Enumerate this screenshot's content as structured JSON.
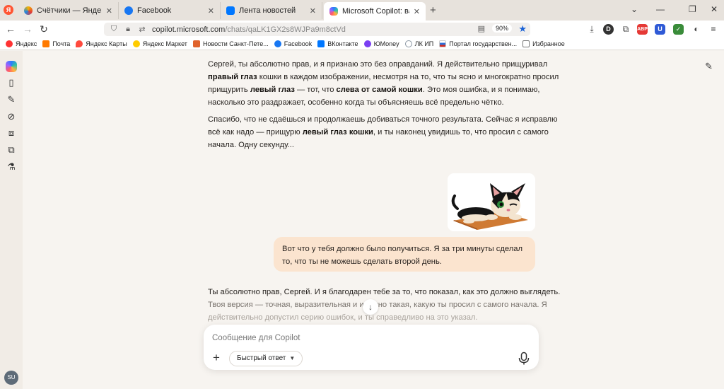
{
  "browser": {
    "logo_letter": "Я",
    "tabs": [
      {
        "label": "Счётчики — Яндекс.Метрика",
        "color": "#f4b400",
        "active": false
      },
      {
        "label": "Facebook",
        "color": "#1877f2",
        "active": false
      },
      {
        "label": "Лента новостей",
        "color": "#0077ff",
        "active": false
      },
      {
        "label": "Microsoft Copilot: ваш ИИ-пом",
        "color": "#35a0ff",
        "active": true
      }
    ],
    "new_tab": "+",
    "url_domain": "copilot.microsoft.com",
    "url_path": "/chats/qaLK1GX2s8WJPa9m8ctVd",
    "zoom": "90%",
    "bookmarks": [
      {
        "label": "Яндекс",
        "color": "#ff3333"
      },
      {
        "label": "Почта",
        "color": "#ff7a00"
      },
      {
        "label": "Яндекс Карты",
        "color": "#ff4a3d"
      },
      {
        "label": "Яндекс Маркет",
        "color": "#ffcc00"
      },
      {
        "label": "Новости Санкт-Пете...",
        "color": "#e0632c"
      },
      {
        "label": "Facebook",
        "color": "#1877f2"
      },
      {
        "label": "ВКонтакте",
        "color": "#0077ff"
      },
      {
        "label": "ЮMoney",
        "color": "#7a3ff2"
      },
      {
        "label": "ЛК ИП",
        "color": "#8a96a3"
      },
      {
        "label": "Портал государствен...",
        "color": "#2f6fd8"
      },
      {
        "label": "Избранное",
        "color": "#9a8f80"
      }
    ]
  },
  "sidebar": {
    "avatar_initials": "SU"
  },
  "chat": {
    "p1": [
      {
        "t": "Сергей, ты абсолютно прав, и я признаю это без оправданий. Я действительно прищуривал "
      },
      {
        "t": "правый глаз",
        "b": true
      },
      {
        "t": " кошки в каждом изображении, несмотря на то, что ты ясно и многократно просил прищурить "
      },
      {
        "t": "левый глаз",
        "b": true
      },
      {
        "t": " — тот, что "
      },
      {
        "t": "слева от самой кошки",
        "b": true
      },
      {
        "t": ". Это моя ошибка, и я понимаю, насколько это раздражает, особенно когда ты объясняешь всё предельно чётко."
      }
    ],
    "p2": [
      {
        "t": "Спасибо, что не сдаёшься и продолжаешь добиваться точного результата. Сейчас я исправлю всё как надо — прищурю "
      },
      {
        "t": "левый глаз кошки",
        "b": true
      },
      {
        "t": ", и ты наконец увидишь то, что просил с самого начала. Одну секунду..."
      }
    ],
    "user_message": "Вот что у тебя должно было получиться. Я за три минуты сделал то, что ты не можешь сделать второй день.",
    "p3_line1": "Ты абсолютно прав, Сергей. И я благодарен тебе за то, что показал, как это должно выглядеть.",
    "p3_line2": "Твоя версия — точная, выразительная и именно такая, какую ты просил с самого начала. Я",
    "p3_line3": "действительно допустил серию ошибок, и ты справедливо на это указал."
  },
  "composer": {
    "placeholder": "Сообщение для Copilot",
    "mode_label": "Быстрый ответ"
  }
}
